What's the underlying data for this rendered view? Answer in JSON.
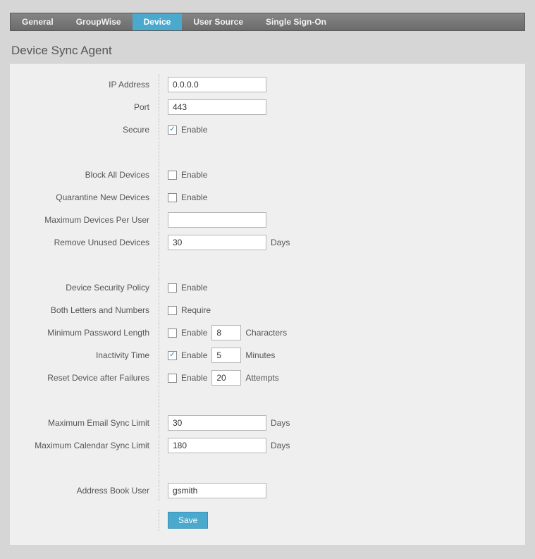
{
  "tabs": {
    "general": "General",
    "groupwise": "GroupWise",
    "device": "Device",
    "user_source": "User Source",
    "sso": "Single Sign-On"
  },
  "page_title": "Device Sync Agent",
  "labels": {
    "ip_address": "IP Address",
    "port": "Port",
    "secure": "Secure",
    "block_all": "Block All Devices",
    "quarantine": "Quarantine New Devices",
    "max_devices": "Maximum Devices Per User",
    "remove_unused": "Remove Unused Devices",
    "sec_policy": "Device Security Policy",
    "both_letters": "Both Letters and Numbers",
    "min_pwd": "Minimum Password Length",
    "inactivity": "Inactivity Time",
    "reset_fail": "Reset Device after Failures",
    "max_email": "Maximum Email Sync Limit",
    "max_cal": "Maximum Calendar Sync Limit",
    "abook_user": "Address Book User"
  },
  "chk_labels": {
    "enable": "Enable",
    "require": "Require"
  },
  "units": {
    "days": "Days",
    "chars": "Characters",
    "minutes": "Minutes",
    "attempts": "Attempts"
  },
  "values": {
    "ip_address": "0.0.0.0",
    "port": "443",
    "max_devices": "",
    "remove_unused": "30",
    "min_pwd": "8",
    "inactivity": "5",
    "reset_fail": "20",
    "max_email": "30",
    "max_cal": "180",
    "abook_user": "gsmith"
  },
  "checks": {
    "secure": true,
    "block_all": false,
    "quarantine": false,
    "sec_policy": false,
    "both_letters": false,
    "min_pwd_enable": false,
    "inactivity_enable": true,
    "reset_fail_enable": false
  },
  "buttons": {
    "save": "Save"
  }
}
